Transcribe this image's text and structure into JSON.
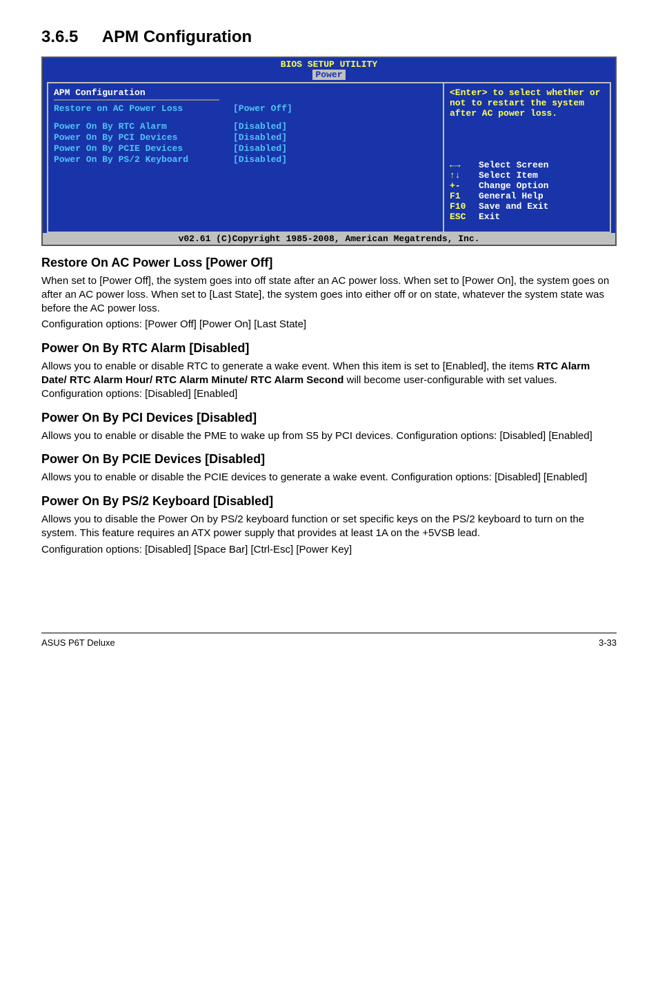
{
  "section": {
    "number": "3.6.5",
    "title": "APM Configuration"
  },
  "bios": {
    "header": "BIOS SETUP UTILITY",
    "tab": "Power",
    "panel_title": "APM Configuration",
    "rows": [
      {
        "label": "Restore on AC Power Loss",
        "value": "[Power Off]"
      },
      {
        "label": "Power On By RTC Alarm",
        "value": "[Disabled]"
      },
      {
        "label": "Power On By PCI Devices",
        "value": "[Disabled]"
      },
      {
        "label": "Power On By PCIE Devices",
        "value": "[Disabled]"
      },
      {
        "label": "Power On By PS/2 Keyboard",
        "value": "[Disabled]"
      }
    ],
    "help_text": "<Enter> to select whether or not to restart the system after AC power loss.",
    "keys": [
      {
        "sym": "←→",
        "label": "Select Screen"
      },
      {
        "sym": "↑↓",
        "label": "Select Item"
      },
      {
        "sym": "+-",
        "label": " Change Option"
      },
      {
        "sym": "F1",
        "label": "General Help"
      },
      {
        "sym": "F10",
        "label": "Save and Exit"
      },
      {
        "sym": "ESC",
        "label": "Exit"
      }
    ],
    "footer": "v02.61 (C)Copyright 1985-2008, American Megatrends, Inc."
  },
  "sub1": {
    "title": "Restore On AC Power Loss [Power Off]",
    "p1": "When set to [Power Off], the system goes into off state after an AC power loss. When set to [Power On], the system goes on after an AC power loss. When set to [Last State], the system goes into either off or on state, whatever the system state was before the AC power loss.",
    "p2": "Configuration options: [Power Off] [Power On] [Last State]"
  },
  "sub2": {
    "title": "Power On By RTC Alarm [Disabled]",
    "p1a": "Allows you to enable or disable RTC to generate a wake event. When this item is set to [Enabled], the items ",
    "p1b": "RTC Alarm Date/ RTC Alarm Hour/ RTC Alarm Minute/ RTC Alarm Second",
    "p1c": " will become user-configurable with set values. Configuration options: [Disabled] [Enabled]"
  },
  "sub3": {
    "title": "Power On By PCI Devices [Disabled]",
    "p1": "Allows you to enable or disable the PME to wake up from S5 by PCI devices. Configuration options: [Disabled] [Enabled]"
  },
  "sub4": {
    "title": "Power On By PCIE Devices [Disabled]",
    "p1": "Allows you to enable or disable the PCIE devices to generate a wake event. Configuration options: [Disabled] [Enabled]"
  },
  "sub5": {
    "title": "Power On By PS/2 Keyboard [Disabled]",
    "p1": "Allows you to disable the Power On by PS/2 keyboard function or set specific keys on the PS/2 keyboard to turn on the system. This feature requires an ATX power supply that provides at least 1A on the +5VSB lead.",
    "p2": "Configuration options: [Disabled] [Space Bar] [Ctrl-Esc] [Power Key]"
  },
  "footer": {
    "left": "ASUS P6T Deluxe",
    "right": "3-33"
  }
}
